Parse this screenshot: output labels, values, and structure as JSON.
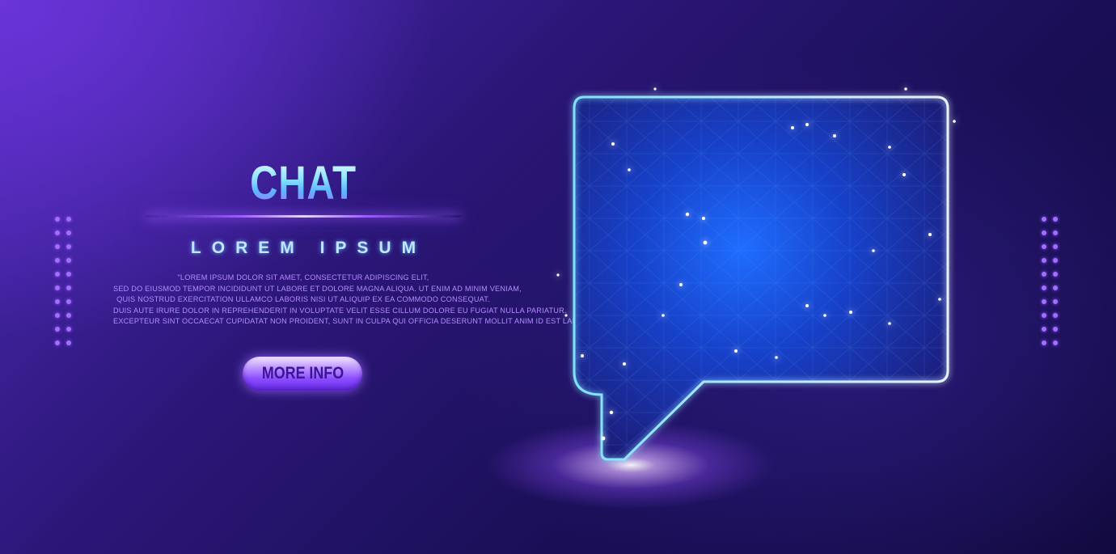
{
  "hero": {
    "title": "CHAT",
    "subtitle": "LOREM IPSUM",
    "body_lines": [
      "\"LOREM IPSUM DOLOR SIT AMET, CONSECTETUR ADIPISCING ELIT,",
      "SED DO EIUSMOD TEMPOR INCIDIDUNT UT LABORE ET DOLORE MAGNA ALIQUA. UT ENIM AD MINIM VENIAM,",
      "QUIS NOSTRUD EXERCITATION ULLAMCO LABORIS NISI UT ALIQUIP EX EA COMMODO CONSEQUAT.",
      "DUIS AUTE IRURE DOLOR IN REPREHENDERIT IN VOLUPTATE VELIT ESSE CILLUM DOLORE EU FUGIAT NULLA PARIATUR.",
      "EXCEPTEUR SINT OCCAECAT CUPIDATAT NON PROIDENT, SUNT IN CULPA QUI OFFICIA DESERUNT MOLLIT ANIM ID EST LABORUM.\""
    ],
    "button_label": "MORE INFO"
  },
  "colors": {
    "background_top_left": "#6a34d8",
    "background_bottom_right": "#120a3f",
    "accent_purple": "#9d5bff",
    "bubble_blue": "#1a4bff",
    "bubble_outline": "#d9e8ff"
  },
  "illustration": {
    "icon": "chat-bubble-icon"
  }
}
